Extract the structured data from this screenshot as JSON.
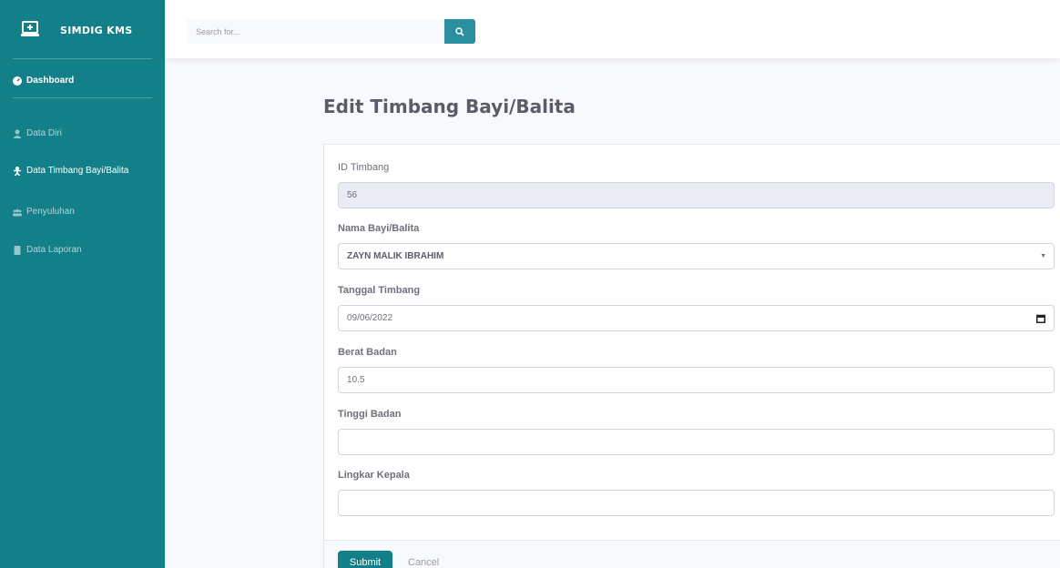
{
  "brand": {
    "name": "SIMDIG KMS",
    "icon": "medical-laptop-icon"
  },
  "sidebar": {
    "items": [
      {
        "label": "Dashboard",
        "icon": "tachometer-icon"
      },
      {
        "label": "Data Diri",
        "icon": "user-icon"
      },
      {
        "label": "Data Timbang Bayi/Balita",
        "icon": "baby-icon"
      },
      {
        "label": "Penyuluhan",
        "icon": "users-icon"
      },
      {
        "label": "Data Laporan",
        "icon": "file-icon"
      }
    ]
  },
  "search": {
    "placeholder": "Search for...",
    "icon": "search-icon"
  },
  "page": {
    "title": "Edit Timbang Bayi/Balita"
  },
  "form": {
    "id_label": "ID Timbang",
    "id_value": "56",
    "nama_label": "Nama Bayi/Balita",
    "nama_value": "ZAYN MALIK IBRAHIM",
    "tanggal_label": "Tanggal Timbang",
    "tanggal_value": "09/06/2022",
    "berat_label": "Berat Badan",
    "berat_value": "10.5",
    "tinggi_label": "Tinggi Badan",
    "tinggi_value": "",
    "lingkar_label": "Lingkar Kepala",
    "lingkar_value": "",
    "submit_label": "Submit",
    "cancel_label": "Cancel"
  },
  "colors": {
    "sidebar": "#138089",
    "accent": "#2a8ea0",
    "background": "#f8f9fc"
  }
}
